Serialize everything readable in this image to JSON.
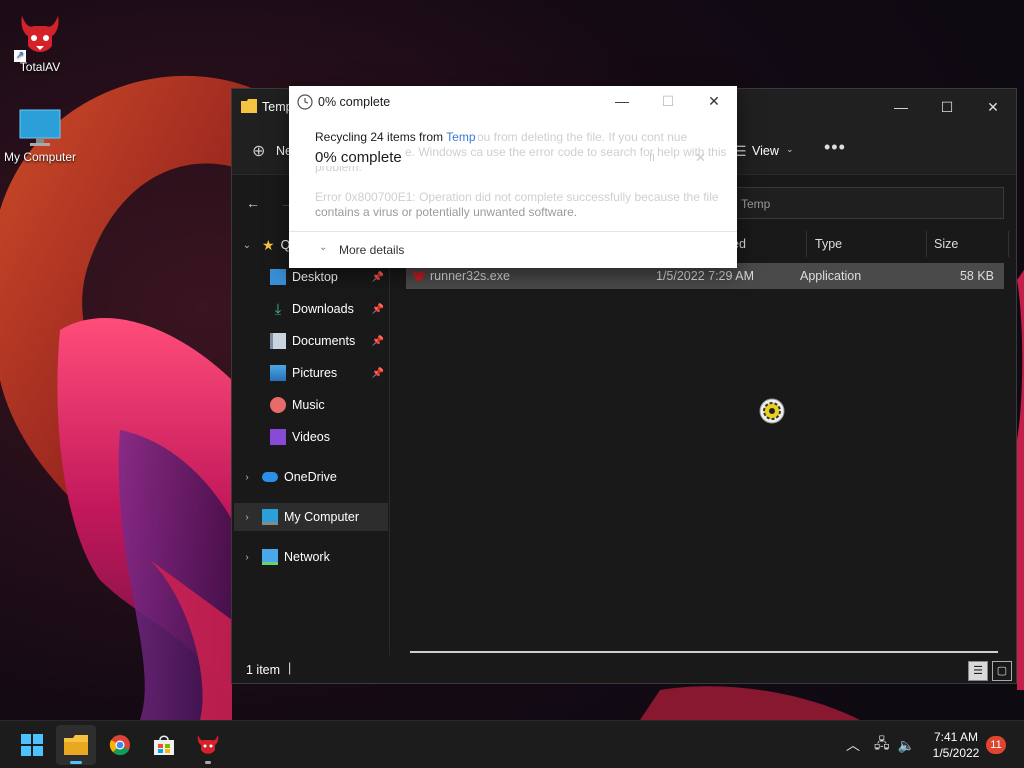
{
  "desktop": {
    "icons": [
      {
        "label": "TotalAV",
        "icon": "totalav-icon"
      },
      {
        "label": "My Computer",
        "icon": "monitor-icon"
      }
    ]
  },
  "explorer": {
    "title": "Temp",
    "toolbar": {
      "new_label": "Ne",
      "view_label": "View"
    },
    "address": {
      "path": "Temp"
    },
    "nav": {
      "quick_access": "Q",
      "items": [
        {
          "label": "Desktop",
          "pinned": true
        },
        {
          "label": "Downloads",
          "pinned": true
        },
        {
          "label": "Documents",
          "pinned": true
        },
        {
          "label": "Pictures",
          "pinned": true
        },
        {
          "label": "Music",
          "pinned": false
        },
        {
          "label": "Videos",
          "pinned": false
        }
      ],
      "roots": [
        {
          "label": "OneDrive"
        },
        {
          "label": "My Computer"
        },
        {
          "label": "Network"
        }
      ]
    },
    "columns": {
      "modified": "ed",
      "type": "Type",
      "size": "Size"
    },
    "files": [
      {
        "name": "runner32s.exe",
        "modified": "1/5/2022 7:29 AM",
        "type": "Application",
        "size": "58 KB"
      }
    ],
    "status": {
      "count": "1 item"
    }
  },
  "dialog": {
    "title": "0% complete",
    "message_prefix": "Recycling 24 items from ",
    "message_link": "Temp",
    "progress_text": "0% complete",
    "progress": 0,
    "ghost_line1": "you from deleting the file. If you cont nue",
    "ghost_line2": "e. Windows ca use the error code to search for help with this",
    "ghost_line3": "problem.",
    "ghost_line4": "Error 0x800700E1: Operation did not complete successfully because the file",
    "ghost_line5": "contains a virus or potentially unwanted software.",
    "more_details": "More details"
  },
  "taskbar": {
    "time": "7:41 AM",
    "date": "1/5/2022",
    "notifications": "11"
  },
  "colors": {
    "accent": "#0067c0",
    "link": "#3a7bd5",
    "badge": "#e0452f"
  }
}
